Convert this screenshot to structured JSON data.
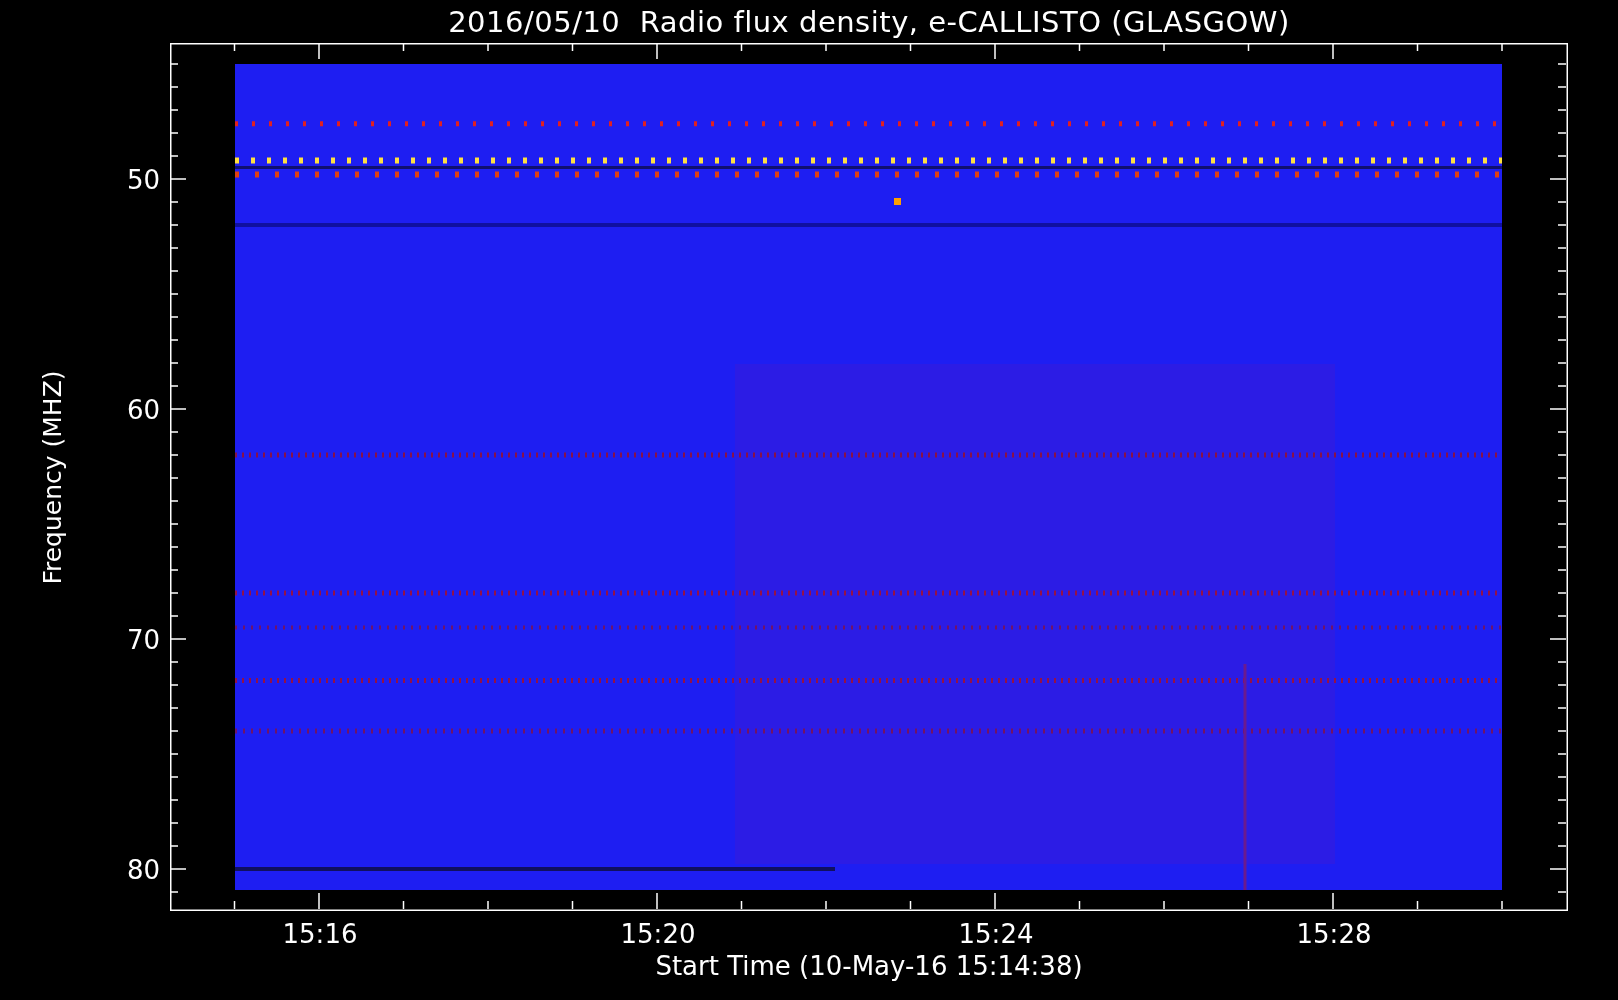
{
  "title": "2016/05/10  Radio flux density, e-CALLISTO (GLASGOW)",
  "y_axis": {
    "label": "Frequency (MHZ)",
    "ticks": [
      "50",
      "60",
      "70",
      "80"
    ]
  },
  "x_axis": {
    "label": "Start Time (10-May-16 15:14:38)",
    "ticks": [
      "15:16",
      "15:20",
      "15:24",
      "15:28"
    ]
  }
}
